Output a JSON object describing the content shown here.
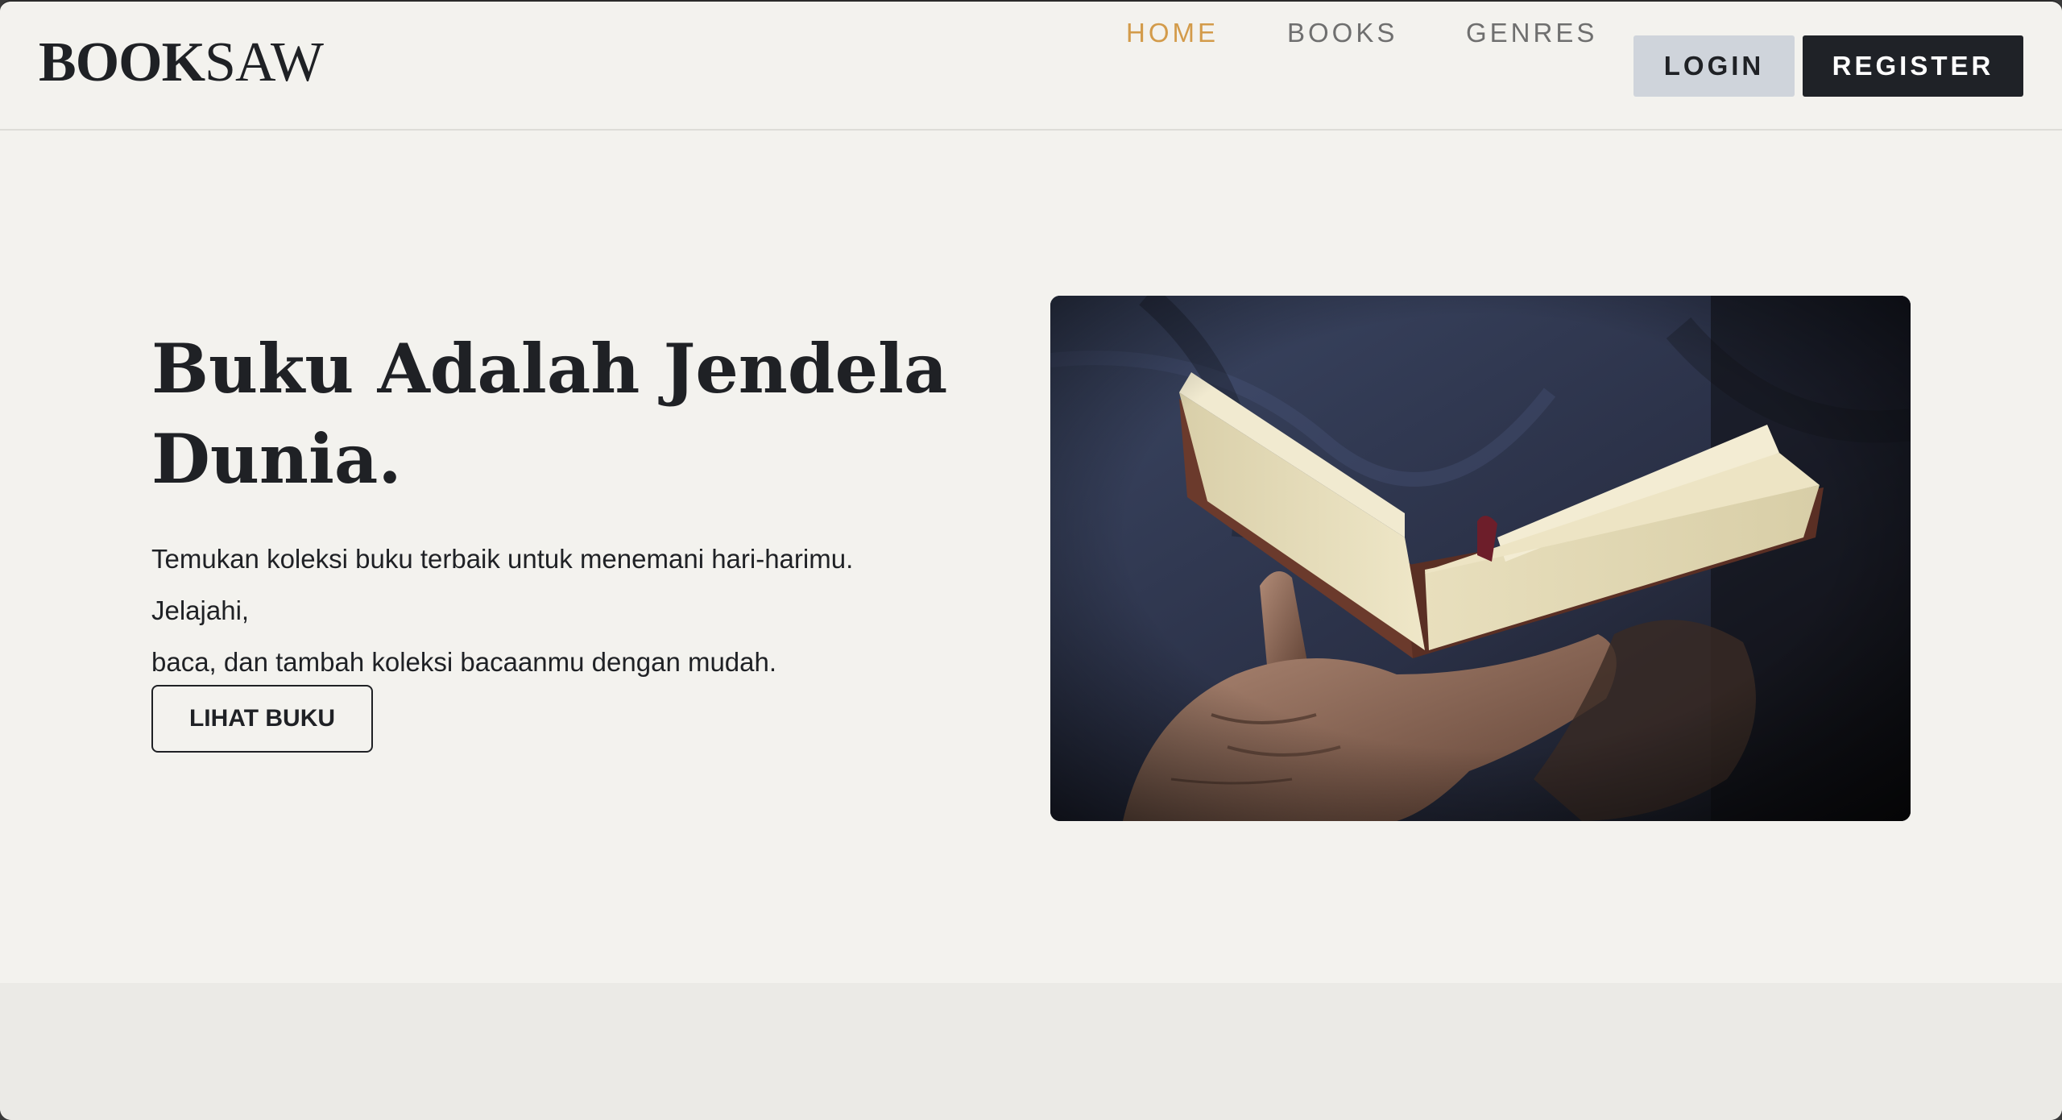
{
  "brand": {
    "logo_bold": "BOOK",
    "logo_thin": "SAW"
  },
  "nav": {
    "items": [
      {
        "label": "HOME",
        "active": true
      },
      {
        "label": "BOOKS",
        "active": false
      },
      {
        "label": "GENRES",
        "active": false
      }
    ],
    "login_label": "LOGIN",
    "register_label": "REGISTER"
  },
  "hero": {
    "title_line1": "Buku Adalah Jendela",
    "title_line2": "Dunia.",
    "text_line1": "Temukan koleksi buku terbaik untuk menemani hari-harimu. Jelajahi,",
    "text_line2": "baca, dan tambah koleksi bacaanmu dengan mudah.",
    "cta_label": "LIHAT BUKU"
  },
  "colors": {
    "background": "#f3f2ee",
    "accent": "#d39b4a",
    "dark": "#1f2227",
    "login_bg": "#cfd4db"
  }
}
